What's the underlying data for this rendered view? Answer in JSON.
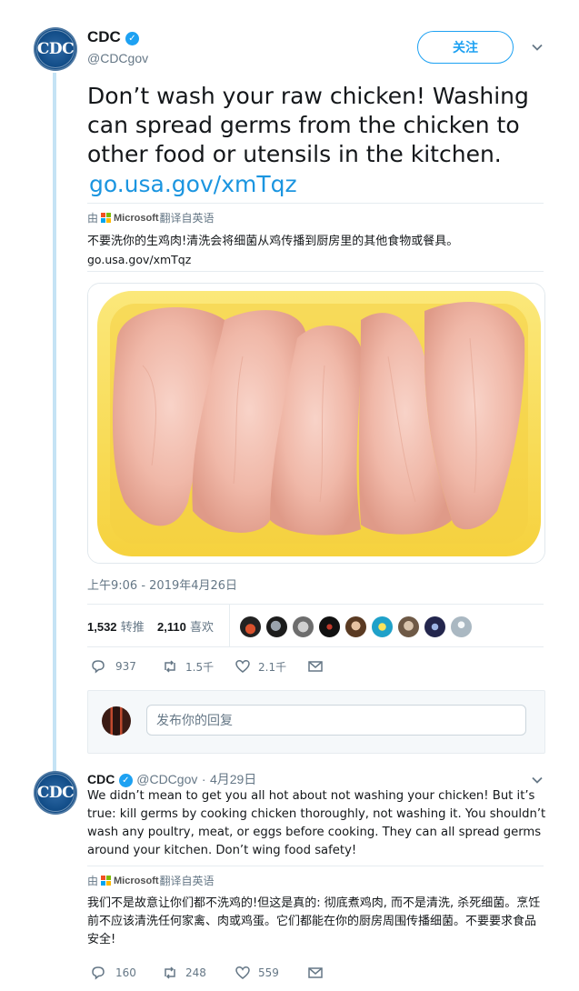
{
  "main_tweet": {
    "author_name": "CDC",
    "author_handle": "@CDCgov",
    "avatar_text": "CDC",
    "follow_label": "关注",
    "text": "Don’t wash your raw chicken! Washing can spread germs from the chicken to other food or utensils in the kitchen.",
    "link": "go.usa.gov/xmTqz",
    "translation": {
      "prefix": "由",
      "brand": "Microsoft",
      "suffix": "翻译自英语",
      "text": "不要洗你的生鸡肉!清洗会将细菌从鸡传播到厨房里的其他食物或餐具。",
      "link": "go.usa.gov/xmTqz"
    },
    "image_alt": "Raw chicken breasts in yellow tray",
    "timestamp": "上午9:06 - 2019年4月26日",
    "retweets_count": "1,532",
    "retweets_label": "转推",
    "likes_count": "2,110",
    "likes_label": "喜欢",
    "actions": {
      "replies": "937",
      "retweets": "1.5千",
      "likes": "2.1千"
    }
  },
  "reply_composer": {
    "placeholder": "发布你的回复"
  },
  "reply_tweet": {
    "author_name": "CDC",
    "author_handle": "@CDCgov",
    "separator": "·",
    "date": "4月29日",
    "avatar_text": "CDC",
    "text": "We didn’t mean to get you all hot about not washing your chicken! But it’s true: kill germs by cooking chicken thoroughly, not washing it. You shouldn’t wash any poultry, meat, or eggs before cooking. They can all spread germs around your kitchen. Don’t wing food safety!",
    "translation": {
      "prefix": "由",
      "brand": "Microsoft",
      "suffix": "翻译自英语",
      "text": "我们不是故意让你们都不洗鸡的!但这是真的: 彻底煮鸡肉, 而不是清洗, 杀死细菌。烹饪前不应该清洗任何家禽、肉或鸡蛋。它们都能在你的厨房周围传播细菌。不要要求食品安全!"
    },
    "actions": {
      "replies": "160",
      "retweets": "248",
      "likes": "559"
    }
  },
  "colors": {
    "accent": "#1da1f2",
    "link": "#1b95e0",
    "muted": "#657786",
    "thread_line": "#c5e3f5"
  }
}
